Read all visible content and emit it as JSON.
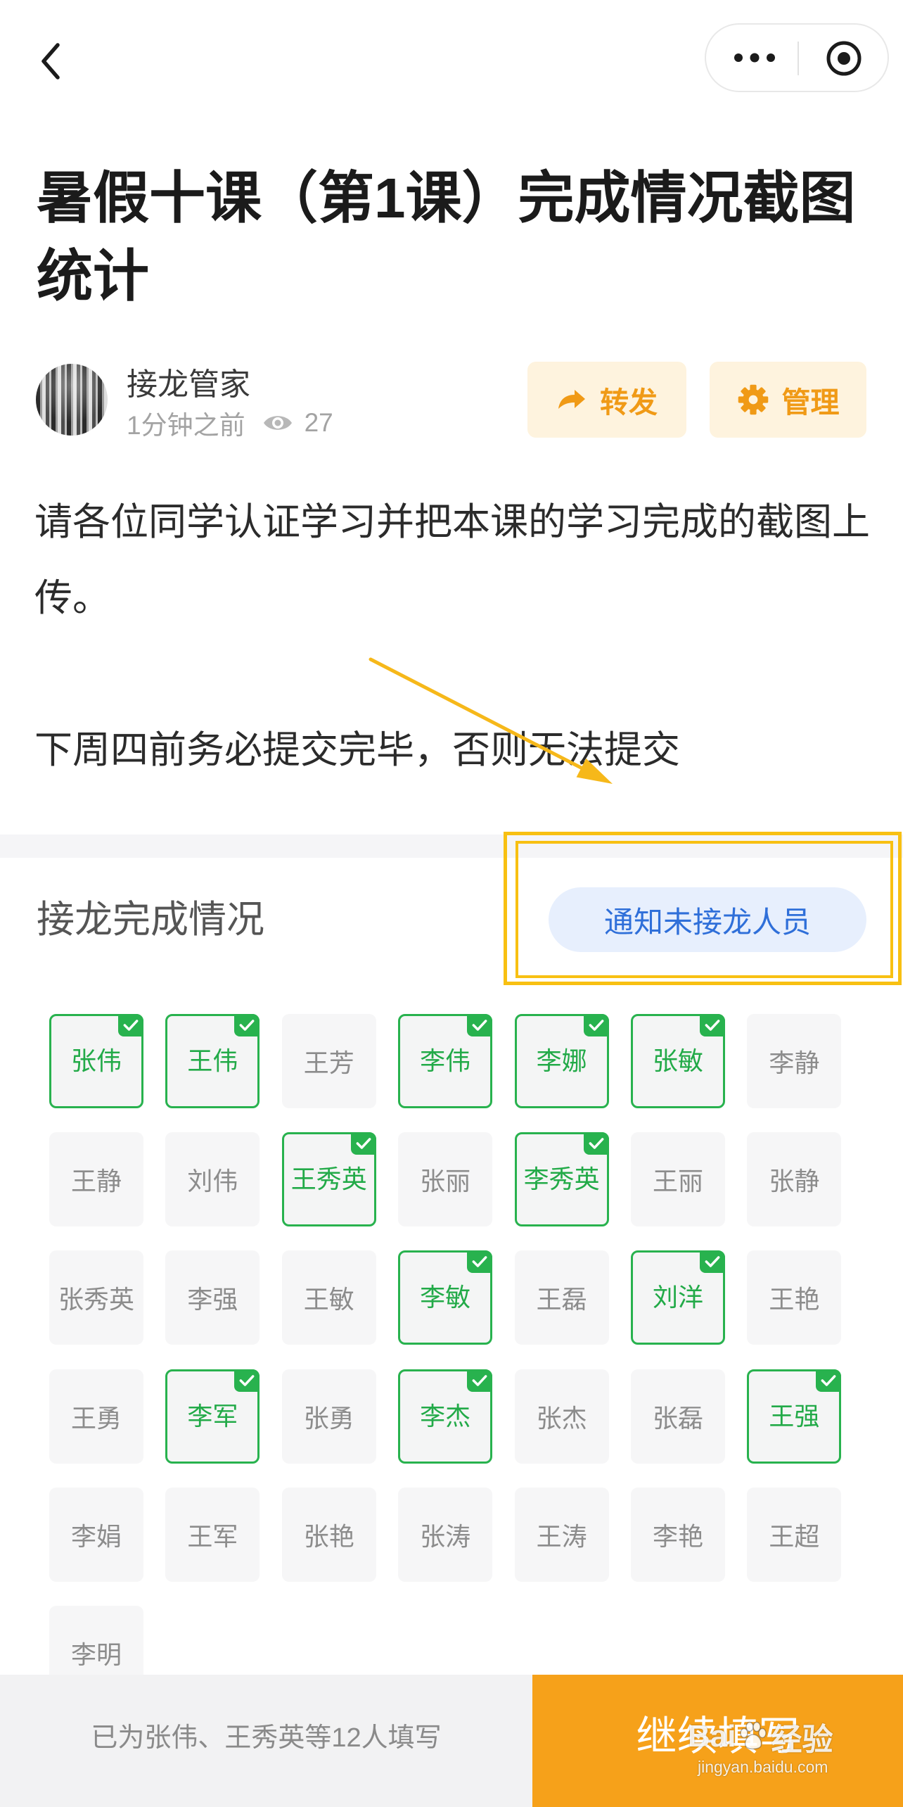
{
  "nav": {
    "back_icon": "chevron-left-icon",
    "more_icon": "more-dots-icon",
    "mini_program_icon": "target-circle-icon"
  },
  "title": "暑假十课（第1课）完成情况截图统计",
  "author": {
    "name": "接龙管家",
    "time": "1分钟之前",
    "views": "27",
    "view_icon": "eye-icon"
  },
  "actions": {
    "share_label": "转发",
    "share_icon": "share-arrow-icon",
    "manage_label": "管理",
    "manage_icon": "gear-icon"
  },
  "description": {
    "instruction": "请各位同学认证学习并把本课的学习完成的截图上传。",
    "deadline": "下周四前务必提交完毕，否则无法提交"
  },
  "status": {
    "heading": "接龙完成情况",
    "notify_label": "通知未接龙人员"
  },
  "participants": [
    {
      "name": "张伟",
      "done": true
    },
    {
      "name": "王伟",
      "done": true
    },
    {
      "name": "王芳",
      "done": false
    },
    {
      "name": "李伟",
      "done": true
    },
    {
      "name": "李娜",
      "done": true
    },
    {
      "name": "张敏",
      "done": true
    },
    {
      "name": "李静",
      "done": false
    },
    {
      "name": "王静",
      "done": false
    },
    {
      "name": "刘伟",
      "done": false
    },
    {
      "name": "王秀英",
      "done": true
    },
    {
      "name": "张丽",
      "done": false
    },
    {
      "name": "李秀英",
      "done": true
    },
    {
      "name": "王丽",
      "done": false
    },
    {
      "name": "张静",
      "done": false
    },
    {
      "name": "张秀英",
      "done": false
    },
    {
      "name": "李强",
      "done": false
    },
    {
      "name": "王敏",
      "done": false
    },
    {
      "name": "李敏",
      "done": true
    },
    {
      "name": "王磊",
      "done": false
    },
    {
      "name": "刘洋",
      "done": true
    },
    {
      "name": "王艳",
      "done": false
    },
    {
      "name": "王勇",
      "done": false
    },
    {
      "name": "李军",
      "done": true
    },
    {
      "name": "张勇",
      "done": false
    },
    {
      "name": "李杰",
      "done": true
    },
    {
      "name": "张杰",
      "done": false
    },
    {
      "name": "张磊",
      "done": false
    },
    {
      "name": "王强",
      "done": true
    },
    {
      "name": "李娟",
      "done": false
    },
    {
      "name": "王军",
      "done": false
    },
    {
      "name": "张艳",
      "done": false
    },
    {
      "name": "张涛",
      "done": false
    },
    {
      "name": "王涛",
      "done": false
    },
    {
      "name": "李艳",
      "done": false
    },
    {
      "name": "王超",
      "done": false
    },
    {
      "name": "李明",
      "done": false
    }
  ],
  "footer": {
    "summary": "已为张伟、王秀英等12人填写",
    "continue_label": "继续填写"
  },
  "watermark": {
    "brand": "Bai",
    "suffix": "经验",
    "url": "jingyan.baidu.com",
    "icon": "paw-icon"
  },
  "colors": {
    "done_green": "#28B24E",
    "action_orange": "#F09A16",
    "action_bg": "#FEF3DE",
    "notify_blue": "#2F6FD9",
    "footer_orange": "#F6A11A",
    "annotation_yellow": "#F8C012"
  }
}
